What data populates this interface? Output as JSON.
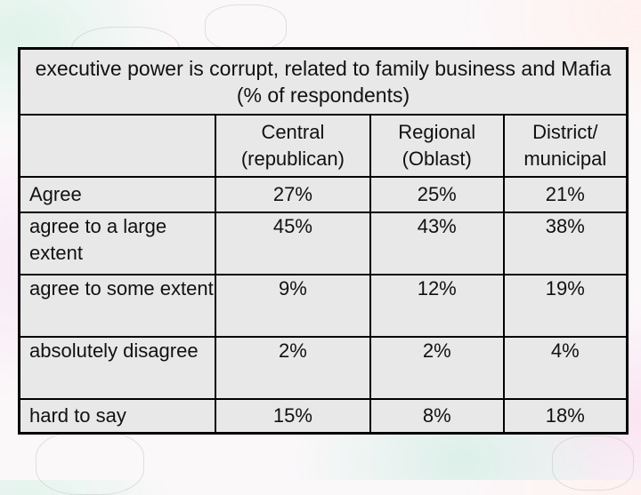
{
  "slide": {
    "background_colors": [
      "#fbf8fa",
      "#dff3ea",
      "#f7e8f5",
      "#dcefe9"
    ],
    "table": {
      "title": "executive power is corrupt, related to family business and Mafia (% of respondents)",
      "columns": [
        {
          "line1": "",
          "line2": ""
        },
        {
          "line1": "Central",
          "line2": "(republican)"
        },
        {
          "line1": "Regional",
          "line2": "(Oblast)"
        },
        {
          "line1": "District/",
          "line2": "municipal"
        }
      ],
      "rows": [
        {
          "label": "Agree",
          "values": [
            "27%",
            "25%",
            "21%"
          ]
        },
        {
          "label": "agree to a large extent",
          "values": [
            "45%",
            "43%",
            "38%"
          ]
        },
        {
          "label": "agree to some extent",
          "values": [
            "9%",
            "12%",
            "19%"
          ]
        },
        {
          "label": "absolutely disagree",
          "values": [
            "2%",
            "2%",
            "4%"
          ]
        },
        {
          "label": "hard to say",
          "values": [
            "15%",
            "8%",
            "18%"
          ]
        }
      ]
    }
  }
}
